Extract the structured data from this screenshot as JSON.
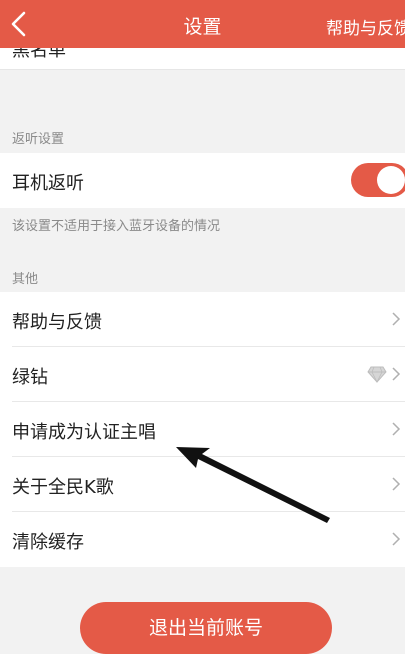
{
  "nav": {
    "title": "设置",
    "right_action": "帮助与反馈"
  },
  "partial_row": {
    "label": "黑名单"
  },
  "monitor_section": {
    "header": "返听设置",
    "item": {
      "label": "耳机返听",
      "toggle_on": true
    },
    "note": "该设置不适用于接入蓝牙设备的情况"
  },
  "other_section": {
    "header": "其他",
    "items": [
      {
        "label": "帮助与反馈"
      },
      {
        "label": "绿钻",
        "icon": "diamond-icon"
      },
      {
        "label": "申请成为认证主唱"
      },
      {
        "label": "关于全民K歌"
      },
      {
        "label": "清除缓存"
      }
    ]
  },
  "logout_label": "退出当前账号",
  "colors": {
    "accent": "#e45a47",
    "background": "#f2f2f2"
  }
}
